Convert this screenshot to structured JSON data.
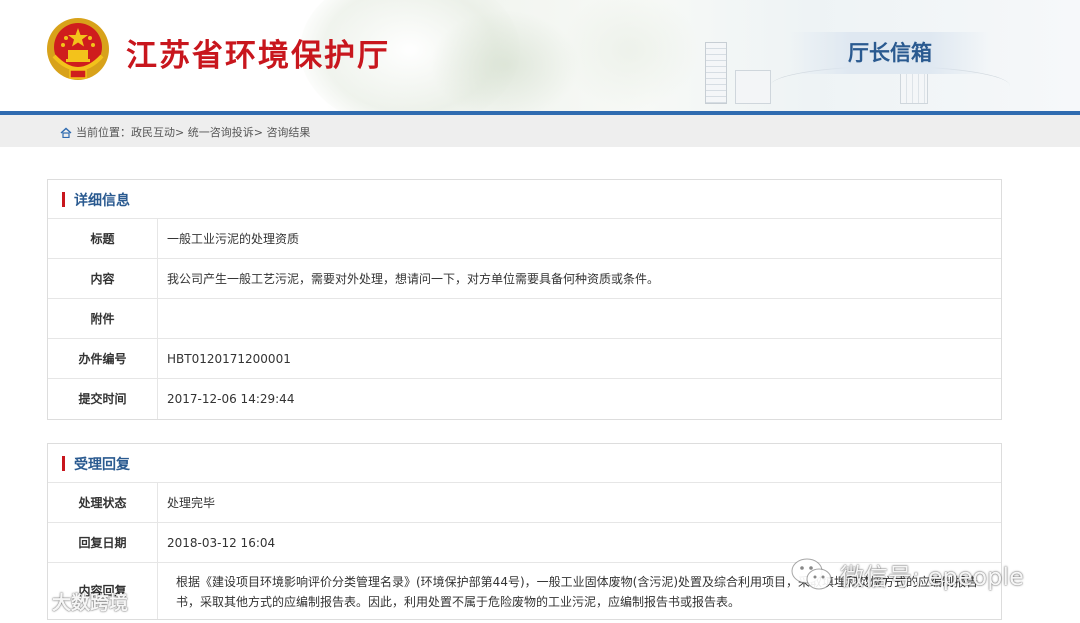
{
  "header": {
    "site_title": "江苏省环境保护厅",
    "mailbox_tab": "厅长信箱"
  },
  "breadcrumb": {
    "prefix": "当前位置：",
    "items": [
      "政民互动",
      "统一咨询投诉",
      "咨询结果"
    ],
    "separator": ">"
  },
  "detail": {
    "title": "详细信息",
    "rows": [
      {
        "label": "标题",
        "value": "一般工业污泥的处理资质"
      },
      {
        "label": "内容",
        "value": "我公司产生一般工艺污泥，需要对外处理，想请问一下，对方单位需要具备何种资质或条件。"
      },
      {
        "label": "附件",
        "value": ""
      },
      {
        "label": "办件编号",
        "value": "HBT0120171200001"
      },
      {
        "label": "提交时间",
        "value": "2017-12-06 14:29:44"
      }
    ]
  },
  "reply": {
    "title": "受理回复",
    "rows": [
      {
        "label": "处理状态",
        "value": "处理完毕"
      },
      {
        "label": "回复日期",
        "value": "2018-03-12 16:04"
      },
      {
        "label": "内容回复",
        "value": "根据《建设项目环境影响评价分类管理名录》(环境保护部第44号)，一般工业固体废物(含污泥)处置及综合利用项目，采取填埋和焚烧方式的应编制报告书，采取其他方式的应编制报告表。因此，利用处置不属于危险废物的工业污泥，应编制报告书或报告表。"
      }
    ]
  },
  "watermarks": {
    "left": "大数跨境",
    "right": "微信号: epeople"
  },
  "colors": {
    "brand_red": "#c8161d",
    "brand_blue": "#2f6bb0",
    "heading_blue": "#2a5a90"
  }
}
